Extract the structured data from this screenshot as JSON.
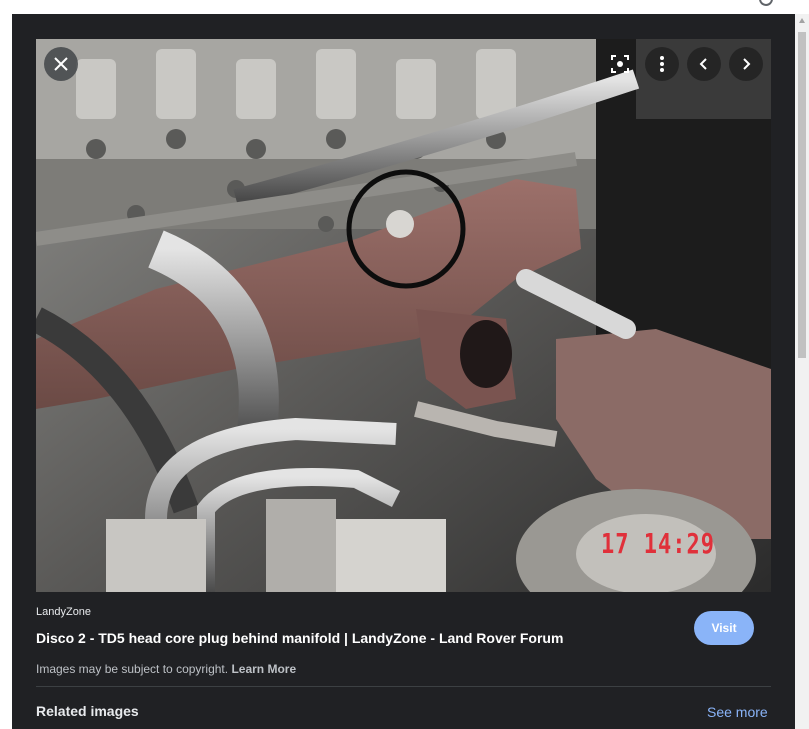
{
  "viewer": {
    "close_icon": "close-icon",
    "lens_icon": "lens-icon",
    "more_icon": "more-vert-icon",
    "prev_icon": "chevron-left-icon",
    "next_icon": "chevron-right-icon",
    "image_stamp": "17  14:29"
  },
  "result": {
    "source": "LandyZone",
    "title": "Disco 2 - TD5 head core plug behind manifold | LandyZone - Land Rover Forum",
    "visit_label": "Visit",
    "copyright_text": "Images may be subject to copyright.",
    "learn_more_label": "Learn More"
  },
  "related": {
    "heading": "Related images",
    "see_more_label": "See more"
  },
  "colors": {
    "panel_bg": "#202124",
    "accent": "#8ab4f8",
    "stamp": "#e0303a"
  }
}
